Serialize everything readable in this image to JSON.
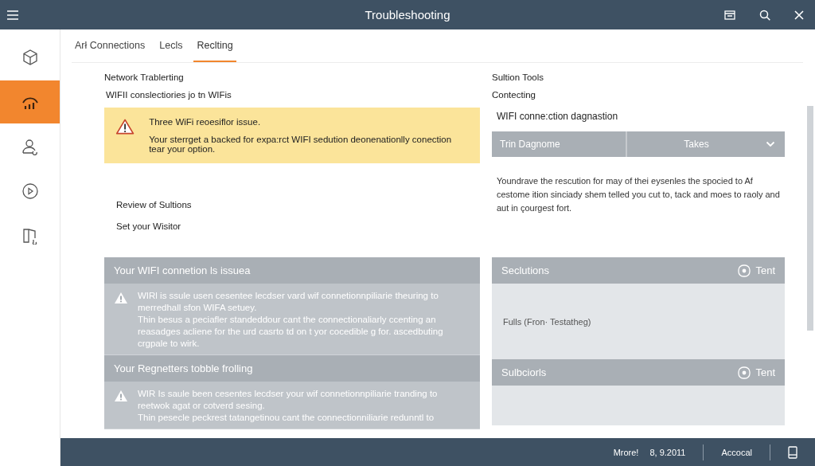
{
  "window": {
    "title": "Troubleshooting"
  },
  "sidebar": {
    "items": [
      {
        "kind": "cube",
        "selected": false
      },
      {
        "kind": "signal",
        "selected": true
      },
      {
        "kind": "user",
        "selected": false
      },
      {
        "kind": "play",
        "selected": false
      },
      {
        "kind": "book",
        "selected": false
      }
    ]
  },
  "tabs": [
    {
      "label": "Arł Connections",
      "selected": false
    },
    {
      "label": "Lecls",
      "selected": false
    },
    {
      "label": "Reclting",
      "selected": true
    }
  ],
  "left": {
    "heading": "Network Trablerting",
    "subheading": "WIFII conslectiories jo tn WIFis",
    "alert": {
      "title": "Three WiFi reoesiflor issue.",
      "body": "Your sterrget a backed for expa:rct WIFI sedution deonenationlly conection tear your option."
    },
    "links": [
      "Review of Sultions",
      "Set your Wisitor"
    ]
  },
  "right": {
    "heading": "Sultion Tools",
    "subheading": "Contecting",
    "section_title": "WIFI conne:ction dagnastion",
    "dropdown": {
      "label": "Trin Dagnome",
      "value": "Takes"
    },
    "description": "Youndrave the rescution for may of thei eysenles the spocied to Af cestome ition sinciady shem telled you cut to, tack and moes to raoly and aut in çourgest fort."
  },
  "issue_panels": [
    {
      "title": "Your WIFI connetion ls issuea",
      "paragraphs": [
        "WIRl is ssule usen cesentee lecdser vard wif connetionnpiliarie theuring to merredhall sfon WIFA setuey.",
        "Thin besus a peciafler standeddour cant the connectionaliarly ccenting an reasadges acliene for the urd casrto td on t yor cocedible g for. ascedbuting crgpale to wirk."
      ]
    },
    {
      "title": "Your Regnetters tobble frolling",
      "paragraphs": [
        "WIR Is saule been cesentes lecdser your wif connetionnpiliarie tranding to reetwok agat or cotverd sesing.",
        "Thin pesecle peckrest tatangetinou cant the connectionniliarie redunntl to"
      ]
    }
  ],
  "solution_panels": [
    {
      "title": "Seclutions",
      "action": "Tent",
      "body": "Fulls (Fron· Testatheg)"
    },
    {
      "title": "Sulbciorls",
      "action": "Tent"
    }
  ],
  "status_bar": {
    "items": [
      "Mrore!",
      "8, 9.2011",
      "Accocal"
    ]
  }
}
